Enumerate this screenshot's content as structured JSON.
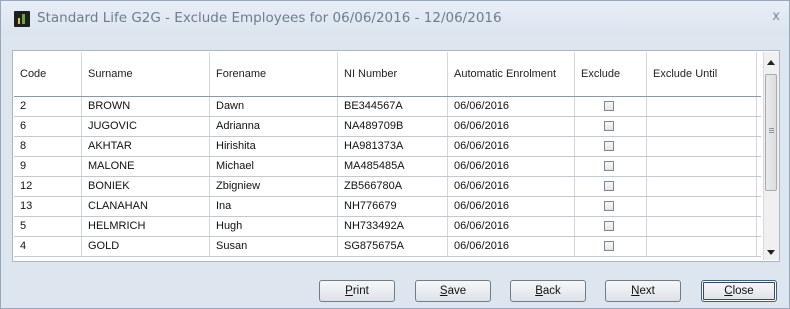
{
  "window": {
    "title": "Standard Life G2G - Exclude Employees for 06/06/2016 - 12/06/2016",
    "close_glyph": "x",
    "app_icon": "chart-app-icon"
  },
  "table": {
    "columns": [
      "Code",
      "Surname",
      "Forename",
      "NI Number",
      "Automatic Enrolment",
      "Exclude",
      "Exclude Until"
    ],
    "rows": [
      {
        "code": "2",
        "surname": "BROWN",
        "forename": "Dawn",
        "ni": "BE344567A",
        "ae": "06/06/2016",
        "exclude": false,
        "until": ""
      },
      {
        "code": "6",
        "surname": "JUGOVIC",
        "forename": "Adrianna",
        "ni": "NA489709B",
        "ae": "06/06/2016",
        "exclude": false,
        "until": ""
      },
      {
        "code": "8",
        "surname": "AKHTAR",
        "forename": "Hirishita",
        "ni": "HA981373A",
        "ae": "06/06/2016",
        "exclude": false,
        "until": ""
      },
      {
        "code": "9",
        "surname": "MALONE",
        "forename": "Michael",
        "ni": "MA485485A",
        "ae": "06/06/2016",
        "exclude": false,
        "until": ""
      },
      {
        "code": "12",
        "surname": "BONIEK",
        "forename": "Zbigniew",
        "ni": "ZB566780A",
        "ae": "06/06/2016",
        "exclude": false,
        "until": ""
      },
      {
        "code": "13",
        "surname": "CLANAHAN",
        "forename": "Ina",
        "ni": "NH776679",
        "ae": "06/06/2016",
        "exclude": false,
        "until": ""
      },
      {
        "code": "5",
        "surname": "HELMRICH",
        "forename": "Hugh",
        "ni": "NH733492A",
        "ae": "06/06/2016",
        "exclude": false,
        "until": ""
      },
      {
        "code": "4",
        "surname": "GOLD",
        "forename": "Susan",
        "ni": "SG875675A",
        "ae": "06/06/2016",
        "exclude": false,
        "until": ""
      }
    ]
  },
  "buttons": {
    "print": "Print",
    "save": "Save",
    "back": "Back",
    "next": "Next",
    "close": "Close"
  }
}
